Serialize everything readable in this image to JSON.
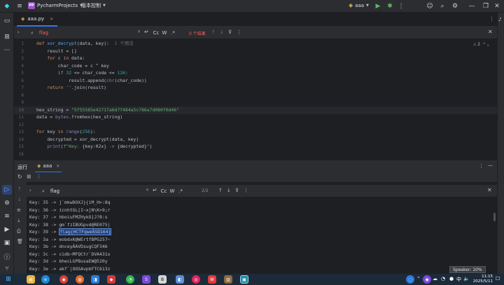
{
  "titlebar": {
    "project_badge": "PP",
    "project_name": "PycharmProjects",
    "vcs_label": "版本控制",
    "run_config": "aaa"
  },
  "tab": {
    "label": "aaa.py"
  },
  "find": {
    "query": "flag",
    "result": "0 个结果",
    "opt_case": "Cc",
    "opt_word": "W",
    "opt_regex": ".*"
  },
  "editor": {
    "warnings": "2",
    "lines": [
      {
        "n": "1",
        "html": "<span class='kw'>def</span> <span class='fn'>xor_decrypt</span>(data, key):  <span class='hint'>1 个用法</span>"
      },
      {
        "n": "2",
        "html": "    result = []"
      },
      {
        "n": "3",
        "html": "    <span class='kw'>for</span> c <span class='kw'>in</span> data:"
      },
      {
        "n": "4",
        "html": "        char_code = c ^ key"
      },
      {
        "n": "5",
        "html": "        <span class='kw'>if</span> <span class='num'>32</span> &lt;= char_code &lt;= <span class='num'>126</span>:"
      },
      {
        "n": "6",
        "html": "            result.append(<span class='bi'>chr</span>(char_code))"
      },
      {
        "n": "7",
        "html": "    <span class='kw'>return</span> <span class='str'>''</span>.join(result)"
      },
      {
        "n": "8",
        "html": ""
      },
      {
        "n": "9",
        "html": ""
      },
      {
        "n": "10",
        "html": "hex_string = <span class='str'>\"5f55585e42717a6d7f484a5c786a7d080f0d46\"</span>"
      },
      {
        "n": "11",
        "html": "data = <span class='bi'>bytes</span>.fromhex(hex_string)"
      },
      {
        "n": "12",
        "html": ""
      },
      {
        "n": "13",
        "html": "<span class='kw'>for</span> key <span class='kw'>in</span> <span class='bi'>range</span>(<span class='num'>256</span>):"
      },
      {
        "n": "14",
        "html": "    decrypted = xor_decrypt(data, key)"
      },
      {
        "n": "15",
        "html": "    <span class='bi'>print</span>(<span class='str'>f\"Key: </span>{key:02x}<span class='str'> -&gt; </span>{decrypted}<span class='str'>\"</span>)"
      },
      {
        "n": "16",
        "html": ""
      }
    ]
  },
  "run": {
    "panel_label": "运行",
    "tab_label": "aaa",
    "find_query": "flag",
    "find_result": "2/2",
    "opt_case": "Cc",
    "opt_word": "W",
    "opt_regex": ".*",
    "output": [
      {
        "text": "Key: 35 -> j`mkwDOXJ}{iM_H>:8q"
      },
      {
        "text": "Key: 36 -> icnhtGL[I~xjN\\K>9;r"
      },
      {
        "text": "Key: 37 -> hboiuFMZHykO]J?8:s"
      },
      {
        "text": "Key: 38 -> gm`fzIBUGpvd@RE075|"
      },
      {
        "prefix": "Key: 39 -> ",
        "sel": "flag{HCTFqweÂSD164}"
      },
      {
        "text": "Key: 3a -> eobdxK@WErtfBPG257~"
      },
      {
        "text": "Key: 3b -> dnceyÂAVDsugCQF346"
      },
      {
        "text": "Key: 3c -> cidb~MFQCtr`DVA431x"
      },
      {
        "text": "Key: 3d -> bhecLGPBusaEW@520y"
      },
      {
        "text": "Key: 3e -> akf`|OOSAvpbFTC613z"
      }
    ]
  },
  "speaker": "Speaker: 10%",
  "tray": {
    "lang": "中",
    "time": "11:15",
    "date": "2025/5/11"
  }
}
